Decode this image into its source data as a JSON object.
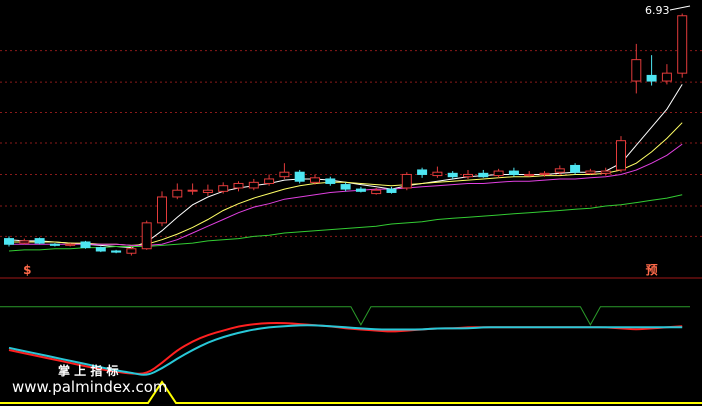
{
  "colors": {
    "background": "#000000",
    "grid": "#8a1a1a",
    "up": "#e23b3b",
    "down": "#4ee6f2",
    "ma_short": "#ffffff",
    "ma_mid": "#ffff66",
    "ma_long": "#e040e0",
    "ma_longer": "#33cc33",
    "sub_green": "#2a9a2a",
    "sub_red": "#ff2020",
    "sub_cyan": "#28c8d8",
    "sub_yellow": "#ffff00",
    "marker_text": "#ff6a4a",
    "watermark": "#ffffff"
  },
  "chart_data": [
    {
      "type": "candlestick",
      "high_label": "6.93",
      "ylim": [
        4.58,
        7.05
      ],
      "gridlines": [
        6.6,
        6.32,
        6.05,
        5.78,
        5.5,
        5.22,
        4.95
      ],
      "candles": [
        {
          "o": 4.93,
          "c": 4.88,
          "h": 4.95,
          "l": 4.86,
          "up": false
        },
        {
          "o": 4.89,
          "c": 4.91,
          "h": 4.93,
          "l": 4.88,
          "up": true
        },
        {
          "o": 4.93,
          "c": 4.89,
          "h": 4.94,
          "l": 4.88,
          "up": false
        },
        {
          "o": 4.88,
          "c": 4.87,
          "h": 4.89,
          "l": 4.86,
          "up": false
        },
        {
          "o": 4.87,
          "c": 4.88,
          "h": 4.89,
          "l": 4.86,
          "up": true
        },
        {
          "o": 4.9,
          "c": 4.85,
          "h": 4.91,
          "l": 4.84,
          "up": false
        },
        {
          "o": 4.85,
          "c": 4.82,
          "h": 4.86,
          "l": 4.81,
          "up": false
        },
        {
          "o": 4.82,
          "c": 4.81,
          "h": 4.83,
          "l": 4.8,
          "up": false
        },
        {
          "o": 4.8,
          "c": 4.84,
          "h": 4.86,
          "l": 4.78,
          "up": true
        },
        {
          "o": 4.84,
          "c": 5.07,
          "h": 5.09,
          "l": 4.83,
          "up": true
        },
        {
          "o": 5.07,
          "c": 5.3,
          "h": 5.35,
          "l": 5.04,
          "up": true
        },
        {
          "o": 5.3,
          "c": 5.36,
          "h": 5.42,
          "l": 5.28,
          "up": true
        },
        {
          "o": 5.36,
          "c": 5.36,
          "h": 5.42,
          "l": 5.32,
          "up": true
        },
        {
          "o": 5.34,
          "c": 5.36,
          "h": 5.41,
          "l": 5.31,
          "up": true
        },
        {
          "o": 5.35,
          "c": 5.4,
          "h": 5.43,
          "l": 5.33,
          "up": true
        },
        {
          "o": 5.38,
          "c": 5.42,
          "h": 5.44,
          "l": 5.35,
          "up": true
        },
        {
          "o": 5.38,
          "c": 5.43,
          "h": 5.46,
          "l": 5.36,
          "up": true
        },
        {
          "o": 5.42,
          "c": 5.46,
          "h": 5.5,
          "l": 5.4,
          "up": true
        },
        {
          "o": 5.48,
          "c": 5.52,
          "h": 5.6,
          "l": 5.46,
          "up": true
        },
        {
          "o": 5.52,
          "c": 5.44,
          "h": 5.54,
          "l": 5.42,
          "up": false
        },
        {
          "o": 5.43,
          "c": 5.47,
          "h": 5.5,
          "l": 5.41,
          "up": true
        },
        {
          "o": 5.46,
          "c": 5.42,
          "h": 5.48,
          "l": 5.4,
          "up": false
        },
        {
          "o": 5.41,
          "c": 5.37,
          "h": 5.43,
          "l": 5.35,
          "up": false
        },
        {
          "o": 5.37,
          "c": 5.35,
          "h": 5.39,
          "l": 5.34,
          "up": false
        },
        {
          "o": 5.33,
          "c": 5.36,
          "h": 5.38,
          "l": 5.32,
          "up": true
        },
        {
          "o": 5.37,
          "c": 5.34,
          "h": 5.39,
          "l": 5.33,
          "up": false
        },
        {
          "o": 5.38,
          "c": 5.5,
          "h": 5.52,
          "l": 5.36,
          "up": true
        },
        {
          "o": 5.54,
          "c": 5.5,
          "h": 5.56,
          "l": 5.47,
          "up": false
        },
        {
          "o": 5.49,
          "c": 5.52,
          "h": 5.57,
          "l": 5.47,
          "up": true
        },
        {
          "o": 5.51,
          "c": 5.48,
          "h": 5.53,
          "l": 5.46,
          "up": false
        },
        {
          "o": 5.48,
          "c": 5.5,
          "h": 5.54,
          "l": 5.46,
          "up": true
        },
        {
          "o": 5.51,
          "c": 5.48,
          "h": 5.54,
          "l": 5.47,
          "up": false
        },
        {
          "o": 5.49,
          "c": 5.53,
          "h": 5.55,
          "l": 5.47,
          "up": true
        },
        {
          "o": 5.53,
          "c": 5.5,
          "h": 5.56,
          "l": 5.48,
          "up": false
        },
        {
          "o": 5.49,
          "c": 5.5,
          "h": 5.53,
          "l": 5.48,
          "up": true
        },
        {
          "o": 5.51,
          "c": 5.5,
          "h": 5.53,
          "l": 5.48,
          "up": true
        },
        {
          "o": 5.52,
          "c": 5.55,
          "h": 5.58,
          "l": 5.5,
          "up": true
        },
        {
          "o": 5.58,
          "c": 5.52,
          "h": 5.6,
          "l": 5.5,
          "up": false
        },
        {
          "o": 5.51,
          "c": 5.53,
          "h": 5.55,
          "l": 5.5,
          "up": true
        },
        {
          "o": 5.51,
          "c": 5.53,
          "h": 5.56,
          "l": 5.49,
          "up": true
        },
        {
          "o": 5.54,
          "c": 5.8,
          "h": 5.84,
          "l": 5.52,
          "up": true
        },
        {
          "o": 6.33,
          "c": 6.52,
          "h": 6.66,
          "l": 6.22,
          "up": true
        },
        {
          "o": 6.38,
          "c": 6.33,
          "h": 6.56,
          "l": 6.29,
          "up": false
        },
        {
          "o": 6.33,
          "c": 6.4,
          "h": 6.48,
          "l": 6.3,
          "up": true
        },
        {
          "o": 6.4,
          "c": 6.91,
          "h": 6.93,
          "l": 6.36,
          "up": true
        }
      ],
      "ma": [
        {
          "key": "ma_short",
          "values": [
            4.92,
            4.91,
            4.91,
            4.9,
            4.89,
            4.88,
            4.87,
            4.86,
            4.85,
            4.9,
            5.0,
            5.12,
            5.23,
            5.3,
            5.35,
            5.38,
            5.4,
            5.42,
            5.45,
            5.46,
            5.46,
            5.45,
            5.43,
            5.41,
            5.39,
            5.37,
            5.4,
            5.42,
            5.44,
            5.46,
            5.48,
            5.49,
            5.5,
            5.5,
            5.5,
            5.5,
            5.51,
            5.52,
            5.52,
            5.53,
            5.6,
            5.76,
            5.92,
            6.08,
            6.3
          ]
        },
        {
          "key": "ma_mid",
          "values": [
            4.9,
            4.9,
            4.9,
            4.9,
            4.89,
            4.89,
            4.88,
            4.88,
            4.87,
            4.88,
            4.92,
            4.97,
            5.03,
            5.1,
            5.18,
            5.24,
            5.29,
            5.33,
            5.37,
            5.4,
            5.42,
            5.43,
            5.43,
            5.42,
            5.41,
            5.4,
            5.41,
            5.42,
            5.43,
            5.44,
            5.45,
            5.46,
            5.47,
            5.48,
            5.48,
            5.49,
            5.49,
            5.5,
            5.5,
            5.51,
            5.54,
            5.6,
            5.7,
            5.82,
            5.96
          ]
        },
        {
          "key": "ma_long",
          "values": [
            4.88,
            4.88,
            4.88,
            4.88,
            4.88,
            4.88,
            4.88,
            4.88,
            4.87,
            4.87,
            4.88,
            4.92,
            4.98,
            5.04,
            5.1,
            5.16,
            5.21,
            5.24,
            5.28,
            5.3,
            5.32,
            5.34,
            5.35,
            5.36,
            5.37,
            5.37,
            5.38,
            5.39,
            5.4,
            5.41,
            5.42,
            5.42,
            5.43,
            5.44,
            5.44,
            5.45,
            5.46,
            5.46,
            5.47,
            5.48,
            5.5,
            5.54,
            5.6,
            5.67,
            5.77
          ]
        },
        {
          "key": "ma_longer",
          "values": [
            4.82,
            4.83,
            4.83,
            4.84,
            4.84,
            4.85,
            4.85,
            4.86,
            4.86,
            4.86,
            4.87,
            4.88,
            4.89,
            4.91,
            4.92,
            4.93,
            4.95,
            4.96,
            4.98,
            4.99,
            5.0,
            5.01,
            5.02,
            5.03,
            5.04,
            5.06,
            5.07,
            5.08,
            5.1,
            5.11,
            5.12,
            5.13,
            5.14,
            5.15,
            5.16,
            5.17,
            5.18,
            5.19,
            5.2,
            5.22,
            5.23,
            5.25,
            5.27,
            5.29,
            5.32
          ]
        }
      ]
    },
    {
      "type": "signal-strip",
      "markers": [
        {
          "index": 1,
          "text": "$"
        },
        {
          "index": 42,
          "text": "预"
        }
      ]
    },
    {
      "type": "line",
      "ylim": [
        0,
        100
      ],
      "green_series": [
        90,
        90,
        90,
        90,
        90,
        90,
        90,
        90,
        90,
        90,
        90,
        90,
        90,
        90,
        90,
        90,
        90,
        90,
        90,
        90,
        90,
        90,
        90,
        90,
        90,
        90,
        90,
        90,
        90,
        90,
        90,
        90,
        90,
        90,
        90,
        90,
        90,
        90,
        90,
        90,
        90,
        90,
        90,
        90,
        90
      ],
      "green_dips": [
        23,
        38
      ],
      "red_series": [
        50,
        47,
        44,
        41,
        38,
        35,
        32,
        30,
        28,
        28,
        38,
        50,
        58,
        64,
        68,
        72,
        74,
        75,
        75,
        74,
        73,
        72,
        70,
        69,
        68,
        67,
        68,
        69,
        70,
        70,
        71,
        71,
        71,
        71,
        71,
        71,
        71,
        71,
        71,
        71,
        70,
        69,
        70,
        71,
        72
      ],
      "cyan_series": [
        52,
        49,
        46,
        43,
        40,
        37,
        34,
        31,
        29,
        26,
        33,
        42,
        50,
        57,
        62,
        66,
        69,
        71,
        72,
        73,
        73,
        72,
        71,
        70,
        69,
        69,
        69,
        69,
        70,
        70,
        70,
        71,
        71,
        71,
        71,
        71,
        71,
        71,
        71,
        71,
        71,
        71,
        71,
        71,
        71
      ]
    }
  ],
  "watermark": {
    "cn": "掌 上 指 标",
    "url": "www.palmindex.com"
  }
}
